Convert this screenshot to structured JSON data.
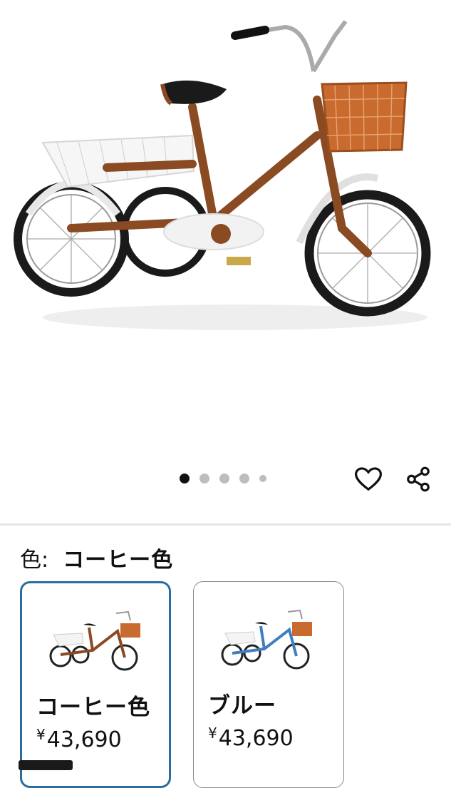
{
  "product": {
    "image_alt": "Tricycle with front and rear baskets"
  },
  "gallery": {
    "dots": 5,
    "active_index": 0
  },
  "actions": {
    "favorite_icon": "heart-icon",
    "share_icon": "share-icon"
  },
  "variant": {
    "label": "色:",
    "selected_value": "コーヒー色"
  },
  "options": [
    {
      "name": "コーヒー色",
      "yen": "¥",
      "price": "43,690",
      "selected": true,
      "frame_color": "#8a4a22"
    },
    {
      "name": "ブルー",
      "yen": "¥",
      "price": "43,690",
      "selected": false,
      "frame_color": "#3f7ec0"
    }
  ],
  "colors": {
    "selected_border": "#2a6d9e",
    "frame_brown": "#8a4a22",
    "basket_orange": "#c96a2e"
  }
}
